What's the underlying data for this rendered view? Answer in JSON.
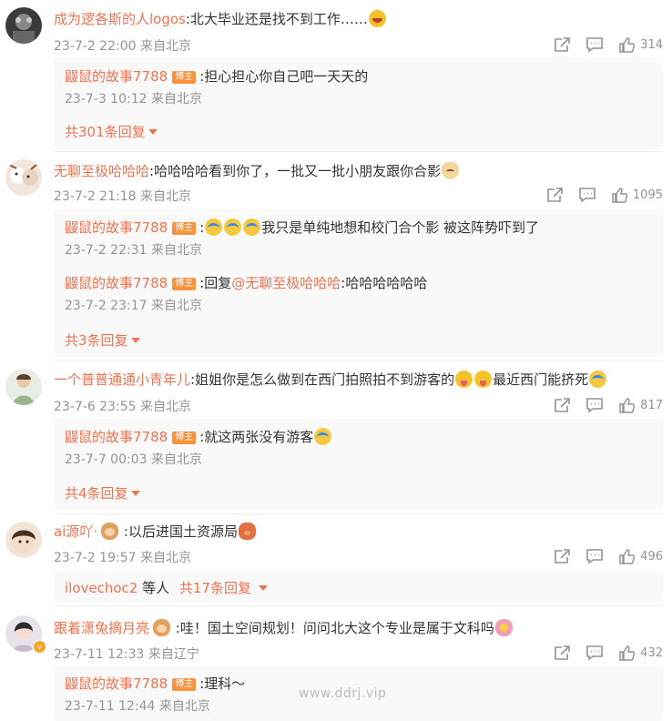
{
  "comments": [
    {
      "user": "成为逻各斯的人logos",
      "text": ":北大毕业还是找不到工作……",
      "time": "23-7-2 22:00 来自北京",
      "likes": "314",
      "replies": [
        {
          "user": "鼹鼠的故事7788",
          "badge": "博主",
          "text": ":担心担心你自己吧一天天的",
          "time": "23-7-3 10:12 来自北京"
        }
      ],
      "more": "共301条回复"
    },
    {
      "user": "无聊至极哈哈哈",
      "text": ":哈哈哈哈看到你了，一批又一批小朋友跟你合影",
      "time": "23-7-2 21:18 来自北京",
      "likes": "1095",
      "replies": [
        {
          "user": "鼹鼠的故事7788",
          "badge": "博主",
          "text": "我只是单纯地想和校门合个影 被这阵势吓到了",
          "time": "23-7-2 22:31 来自北京"
        },
        {
          "user": "鼹鼠的故事7788",
          "badge": "博主",
          "prefix": ":回复",
          "mention": "@无聊至极哈哈哈",
          "text": ":哈哈哈哈哈哈",
          "time": "23-7-2 23:17 来自北京"
        }
      ],
      "more": "共3条回复"
    },
    {
      "user": "一个普普通通小青年儿",
      "text": ":姐姐你是怎么做到在西门拍照拍不到游客的",
      "text2": "最近西门能挤死",
      "time": "23-7-6 23:55 来自北京",
      "likes": "817",
      "replies": [
        {
          "user": "鼹鼠的故事7788",
          "badge": "博主",
          "text": ":就这两张没有游客",
          "time": "23-7-7 00:03 来自北京"
        }
      ],
      "more": "共4条回复"
    },
    {
      "user": "ai源吖·",
      "text": ":以后进国土资源局",
      "time": "23-7-2 19:57 来自北京",
      "likes": "496",
      "summary_user": "ilovechoc2",
      "summary_mid": " 等人",
      "more": "共17条回复"
    },
    {
      "user": "跟着潇兔摘月亮",
      "text": ":哇！国土空间规划！问问北大这个专业是属于文科吗",
      "time": "23-7-11 12:33 来自辽宁",
      "likes": "432",
      "replies": [
        {
          "user": "鼹鼠的故事7788",
          "badge": "博主",
          "text": ":理科～",
          "time": "23-7-11 12:44 来自北京"
        }
      ]
    }
  ],
  "watermark": "www.ddrj.vip",
  "icons": {
    "share": "share-icon",
    "comment": "comment-icon",
    "like": "like-icon"
  }
}
